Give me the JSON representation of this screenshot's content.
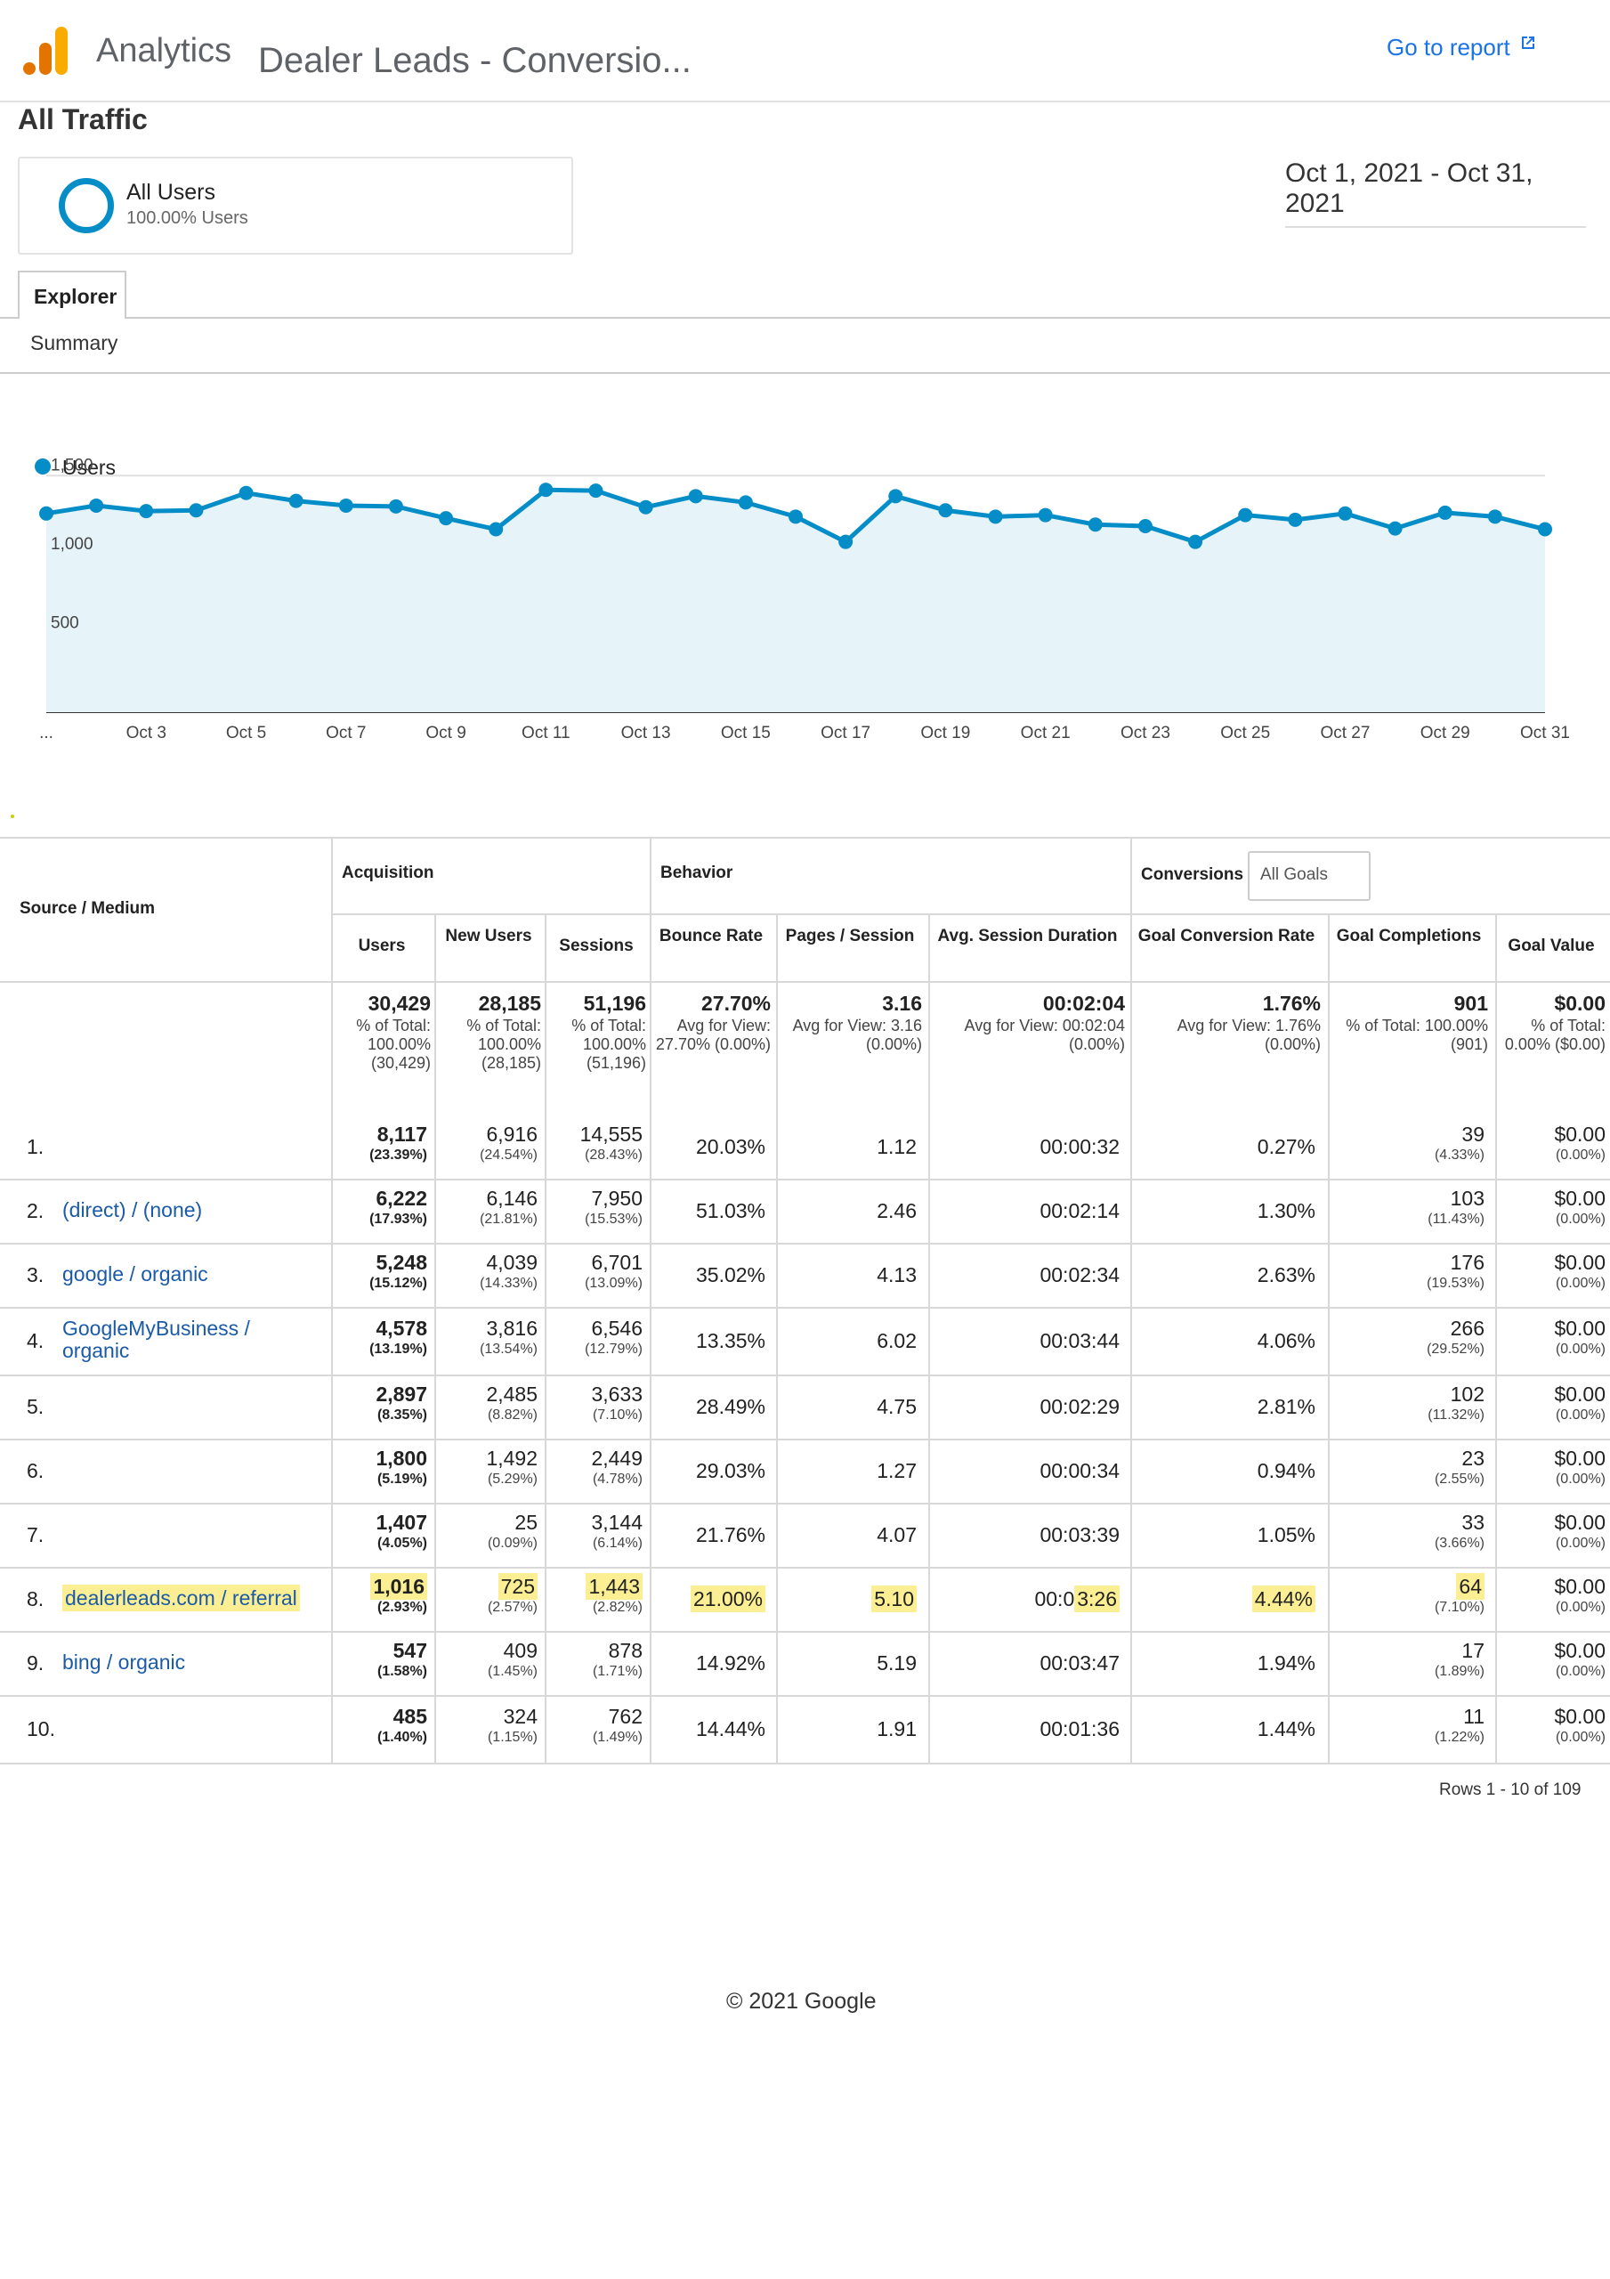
{
  "header": {
    "app_name": "Analytics",
    "report_title": "Dealer Leads - Conversio...",
    "go_to_report": "Go to report"
  },
  "view_title": "All Traffic",
  "segment": {
    "name": "All Users",
    "sub": "100.00% Users"
  },
  "date_range": "Oct 1, 2021 - Oct 31, 2021",
  "tabs": {
    "explorer": "Explorer",
    "summary": "Summary"
  },
  "chart_data": {
    "type": "area",
    "legend": "Users",
    "legend_color": "#058dc7",
    "y_ticks": [
      "1,500",
      "1,000",
      "500"
    ],
    "y_tick_values": [
      1500,
      1000,
      500
    ],
    "ylim": [
      0,
      1750
    ],
    "x_tick_labels": [
      "...",
      "Oct 3",
      "Oct 5",
      "Oct 7",
      "Oct 9",
      "Oct 11",
      "Oct 13",
      "Oct 15",
      "Oct 17",
      "Oct 19",
      "Oct 21",
      "Oct 23",
      "Oct 25",
      "Oct 27",
      "Oct 29",
      "Oct 31"
    ],
    "x": [
      "Oct 1",
      "Oct 2",
      "Oct 3",
      "Oct 4",
      "Oct 5",
      "Oct 6",
      "Oct 7",
      "Oct 8",
      "Oct 9",
      "Oct 10",
      "Oct 11",
      "Oct 12",
      "Oct 13",
      "Oct 14",
      "Oct 15",
      "Oct 16",
      "Oct 17",
      "Oct 18",
      "Oct 19",
      "Oct 20",
      "Oct 21",
      "Oct 22",
      "Oct 23",
      "Oct 24",
      "Oct 25",
      "Oct 26",
      "Oct 27",
      "Oct 28",
      "Oct 29",
      "Oct 30",
      "Oct 31"
    ],
    "series": [
      {
        "name": "Users",
        "values": [
          1260,
          1310,
          1275,
          1280,
          1390,
          1340,
          1310,
          1305,
          1230,
          1160,
          1410,
          1405,
          1300,
          1370,
          1330,
          1240,
          1080,
          1370,
          1280,
          1240,
          1250,
          1190,
          1180,
          1080,
          1250,
          1220,
          1260,
          1165,
          1265,
          1240,
          1160
        ]
      }
    ],
    "grid": true,
    "fill_color": "#e6f3f9"
  },
  "table": {
    "group_headers": {
      "source_medium": "Source / Medium",
      "acquisition": "Acquisition",
      "behavior": "Behavior",
      "conversions": "Conversions",
      "goals_dropdown": "All Goals"
    },
    "columns": [
      "Users",
      "New Users",
      "Sessions",
      "Bounce Rate",
      "Pages / Session",
      "Avg. Session Duration",
      "Goal Conversion Rate",
      "Goal Completions",
      "Goal Value"
    ],
    "totals": [
      {
        "main": "30,429",
        "sub": "% of Total: 100.00% (30,429)"
      },
      {
        "main": "28,185",
        "sub": "% of Total: 100.00% (28,185)"
      },
      {
        "main": "51,196",
        "sub": "% of Total: 100.00% (51,196)"
      },
      {
        "main": "27.70%",
        "sub": "Avg for View: 27.70% (0.00%)"
      },
      {
        "main": "3.16",
        "sub": "Avg for View: 3.16 (0.00%)"
      },
      {
        "main": "00:02:04",
        "sub": "Avg for View: 00:02:04 (0.00%)"
      },
      {
        "main": "1.76%",
        "sub": "Avg for View: 1.76% (0.00%)"
      },
      {
        "main": "901",
        "sub": "% of Total: 100.00% (901)"
      },
      {
        "main": "$0.00",
        "sub": "% of Total: 0.00% ($0.00)"
      }
    ],
    "rows": [
      {
        "idx": "1.",
        "source": "",
        "users": "8,117",
        "users_pct": "(23.39%)",
        "new_users": "6,916",
        "new_users_pct": "(24.54%)",
        "sessions": "14,555",
        "sessions_pct": "(28.43%)",
        "bounce": "20.03%",
        "pages": "1.12",
        "duration": "00:00:32",
        "conv_rate": "0.27%",
        "completions": "39",
        "completions_pct": "(4.33%)",
        "value": "$0.00",
        "value_pct": "(0.00%)"
      },
      {
        "idx": "2.",
        "source": "(direct) / (none)",
        "users": "6,222",
        "users_pct": "(17.93%)",
        "new_users": "6,146",
        "new_users_pct": "(21.81%)",
        "sessions": "7,950",
        "sessions_pct": "(15.53%)",
        "bounce": "51.03%",
        "pages": "2.46",
        "duration": "00:02:14",
        "conv_rate": "1.30%",
        "completions": "103",
        "completions_pct": "(11.43%)",
        "value": "$0.00",
        "value_pct": "(0.00%)"
      },
      {
        "idx": "3.",
        "source": "google / organic",
        "users": "5,248",
        "users_pct": "(15.12%)",
        "new_users": "4,039",
        "new_users_pct": "(14.33%)",
        "sessions": "6,701",
        "sessions_pct": "(13.09%)",
        "bounce": "35.02%",
        "pages": "4.13",
        "duration": "00:02:34",
        "conv_rate": "2.63%",
        "completions": "176",
        "completions_pct": "(19.53%)",
        "value": "$0.00",
        "value_pct": "(0.00%)"
      },
      {
        "idx": "4.",
        "source": "GoogleMyBusiness / organic",
        "users": "4,578",
        "users_pct": "(13.19%)",
        "new_users": "3,816",
        "new_users_pct": "(13.54%)",
        "sessions": "6,546",
        "sessions_pct": "(12.79%)",
        "bounce": "13.35%",
        "pages": "6.02",
        "duration": "00:03:44",
        "conv_rate": "4.06%",
        "completions": "266",
        "completions_pct": "(29.52%)",
        "value": "$0.00",
        "value_pct": "(0.00%)"
      },
      {
        "idx": "5.",
        "source": "",
        "users": "2,897",
        "users_pct": "(8.35%)",
        "new_users": "2,485",
        "new_users_pct": "(8.82%)",
        "sessions": "3,633",
        "sessions_pct": "(7.10%)",
        "bounce": "28.49%",
        "pages": "4.75",
        "duration": "00:02:29",
        "conv_rate": "2.81%",
        "completions": "102",
        "completions_pct": "(11.32%)",
        "value": "$0.00",
        "value_pct": "(0.00%)"
      },
      {
        "idx": "6.",
        "source": "",
        "users": "1,800",
        "users_pct": "(5.19%)",
        "new_users": "1,492",
        "new_users_pct": "(5.29%)",
        "sessions": "2,449",
        "sessions_pct": "(4.78%)",
        "bounce": "29.03%",
        "pages": "1.27",
        "duration": "00:00:34",
        "conv_rate": "0.94%",
        "completions": "23",
        "completions_pct": "(2.55%)",
        "value": "$0.00",
        "value_pct": "(0.00%)"
      },
      {
        "idx": "7.",
        "source": "",
        "users": "1,407",
        "users_pct": "(4.05%)",
        "new_users": "25",
        "new_users_pct": "(0.09%)",
        "sessions": "3,144",
        "sessions_pct": "(6.14%)",
        "bounce": "21.76%",
        "pages": "4.07",
        "duration": "00:03:39",
        "conv_rate": "1.05%",
        "completions": "33",
        "completions_pct": "(3.66%)",
        "value": "$0.00",
        "value_pct": "(0.00%)"
      },
      {
        "idx": "8.",
        "source": "dealerleads.com / referral",
        "users": "1,016",
        "users_pct": "(2.93%)",
        "new_users": "725",
        "new_users_pct": "(2.57%)",
        "sessions": "1,443",
        "sessions_pct": "(2.82%)",
        "bounce": "21.00%",
        "pages": "5.10",
        "duration_prefix": "00:0",
        "duration_hl": "3:26",
        "conv_rate": "4.44%",
        "completions": "64",
        "completions_pct": "(7.10%)",
        "value": "$0.00",
        "value_pct": "(0.00%)",
        "highlight": true
      },
      {
        "idx": "9.",
        "source": "bing / organic",
        "users": "547",
        "users_pct": "(1.58%)",
        "new_users": "409",
        "new_users_pct": "(1.45%)",
        "sessions": "878",
        "sessions_pct": "(1.71%)",
        "bounce": "14.92%",
        "pages": "5.19",
        "duration": "00:03:47",
        "conv_rate": "1.94%",
        "completions": "17",
        "completions_pct": "(1.89%)",
        "value": "$0.00",
        "value_pct": "(0.00%)"
      },
      {
        "idx": "10.",
        "source": "",
        "users": "485",
        "users_pct": "(1.40%)",
        "new_users": "324",
        "new_users_pct": "(1.15%)",
        "sessions": "762",
        "sessions_pct": "(1.49%)",
        "bounce": "14.44%",
        "pages": "1.91",
        "duration": "00:01:36",
        "conv_rate": "1.44%",
        "completions": "11",
        "completions_pct": "(1.22%)",
        "value": "$0.00",
        "value_pct": "(0.00%)"
      }
    ],
    "rows_info": "Rows 1 - 10 of 109"
  },
  "footer": "© 2021 Google",
  "colors": {
    "accent": "#058dc7",
    "link": "#1a73e8",
    "highlight": "#fbee93"
  }
}
